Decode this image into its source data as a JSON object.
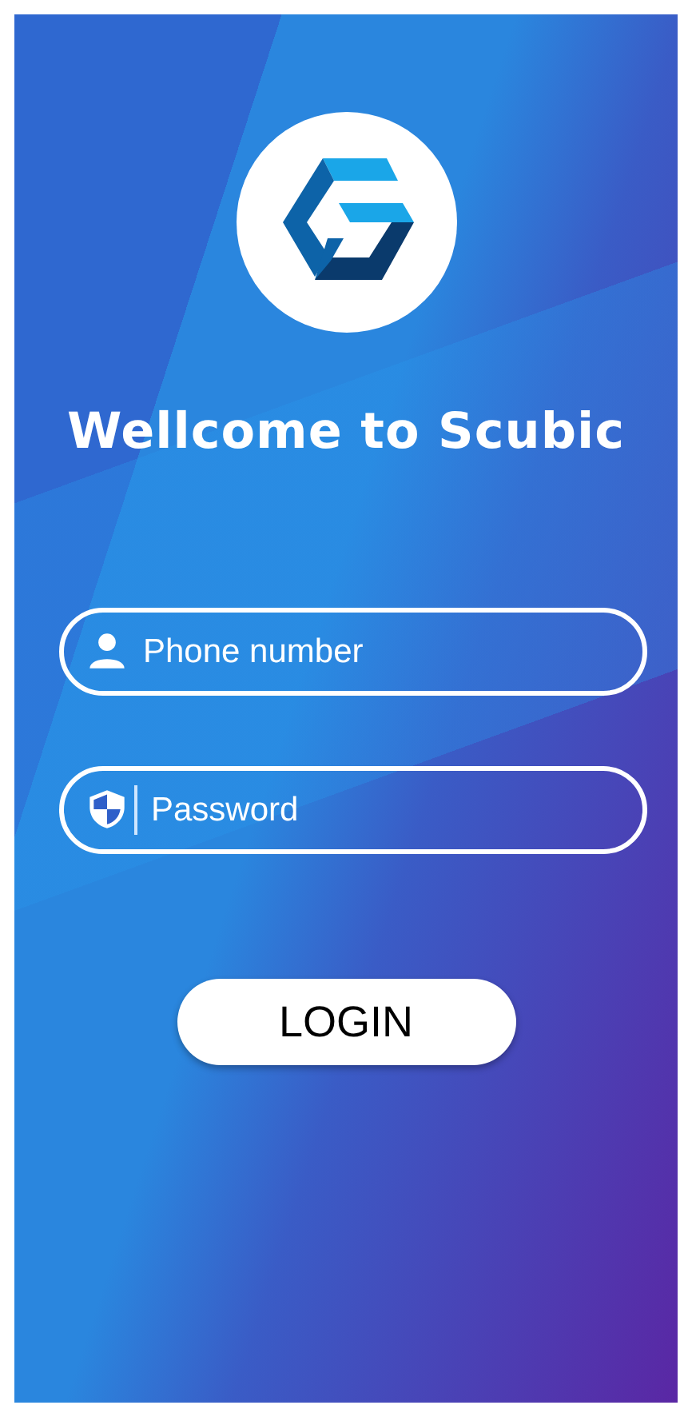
{
  "title": "Wellcome to Scubic",
  "fields": [
    {
      "kind": "user",
      "placeholder": "Phone number",
      "focused": false
    },
    {
      "kind": "shield",
      "placeholder": "Password",
      "focused": true
    }
  ],
  "login_button": {
    "label": "LOGIN"
  }
}
